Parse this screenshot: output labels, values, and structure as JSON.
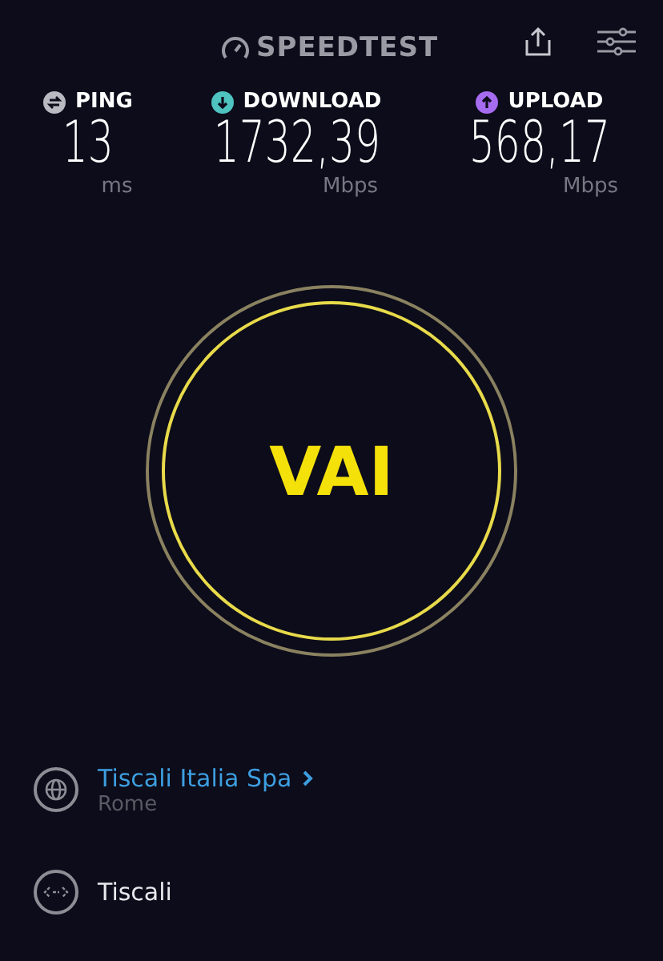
{
  "header": {
    "logo": "SPEEDTEST"
  },
  "metrics": [
    {
      "kind": "ping",
      "label": "PING",
      "value": "13",
      "unit": "ms",
      "color": "#b9b9c2"
    },
    {
      "kind": "download",
      "label": "DOWNLOAD",
      "value": "1732,39",
      "unit": "Mbps",
      "color": "#4ec3c0"
    },
    {
      "kind": "upload",
      "label": "UPLOAD",
      "value": "568,17",
      "unit": "Mbps",
      "color": "#a66cf0"
    }
  ],
  "go_button": {
    "label": "VAI"
  },
  "server": {
    "name": "Tiscali Italia Spa",
    "location": "Rome"
  },
  "isp": {
    "name": "Tiscali"
  }
}
